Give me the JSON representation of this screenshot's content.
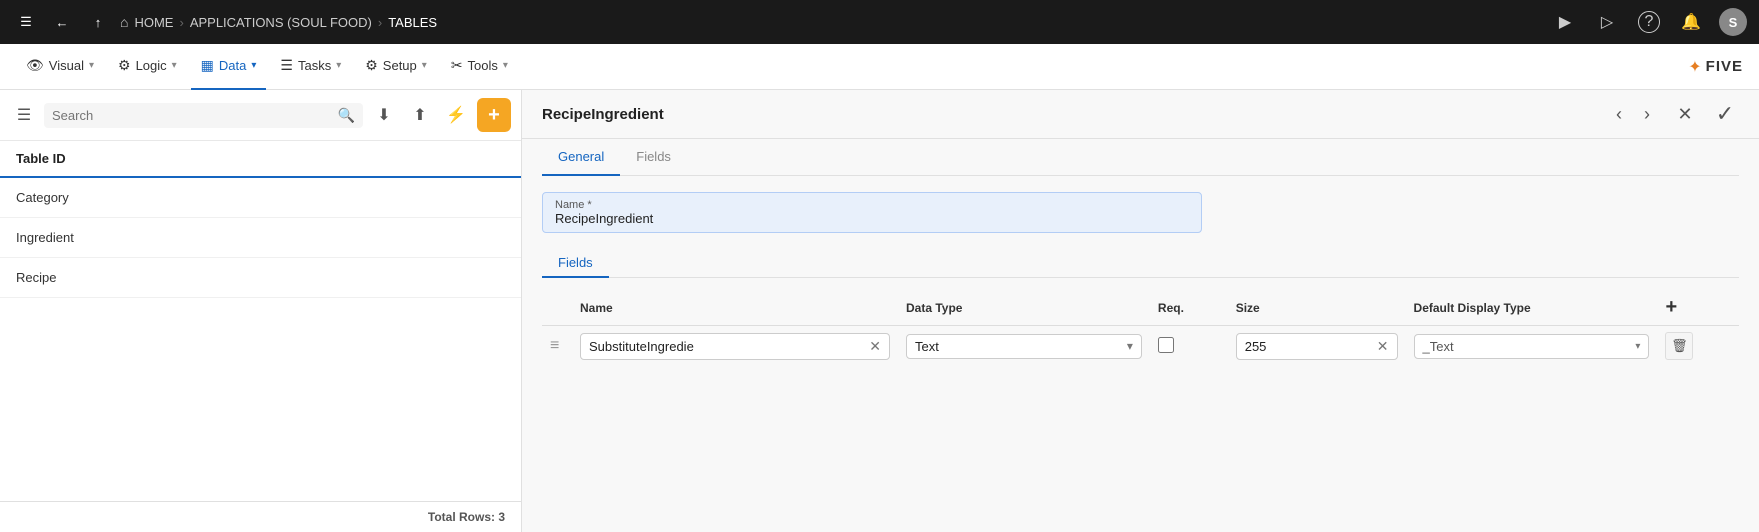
{
  "topbar": {
    "menu_icon": "☰",
    "back_icon": "←",
    "up_icon": "↑",
    "home_icon": "⌂",
    "home_label": "HOME",
    "sep1": "›",
    "app_label": "APPLICATIONS (SOUL FOOD)",
    "sep2": "›",
    "tables_label": "TABLES",
    "play_icon": "▶",
    "replay_icon": "⏵",
    "help_icon": "?",
    "bell_icon": "🔔",
    "avatar_label": "S"
  },
  "secondbar": {
    "visual_icon": "👁",
    "visual_label": "Visual",
    "logic_icon": "⚙",
    "logic_label": "Logic",
    "data_icon": "▦",
    "data_label": "Data",
    "tasks_icon": "☰",
    "tasks_label": "Tasks",
    "setup_icon": "⚙",
    "setup_label": "Setup",
    "tools_icon": "✂",
    "tools_label": "Tools",
    "five_logo": "✦FIVE"
  },
  "sidebar": {
    "search_placeholder": "Search",
    "table_id_header": "Table ID",
    "rows": [
      {
        "label": "Category"
      },
      {
        "label": "Ingredient"
      },
      {
        "label": "Recipe"
      }
    ],
    "total_rows_label": "Total Rows: 3"
  },
  "panel": {
    "title": "RecipeIngredient",
    "close_icon": "✕",
    "confirm_icon": "✓",
    "prev_icon": "‹",
    "next_icon": "›",
    "tabs": [
      {
        "label": "General",
        "active": true
      },
      {
        "label": "Fields",
        "active": false
      }
    ],
    "general": {
      "name_label": "Name *",
      "name_value": "RecipeIngredient"
    },
    "fields": {
      "columns": [
        {
          "label": ""
        },
        {
          "label": "Name"
        },
        {
          "label": "Data Type"
        },
        {
          "label": "Req."
        },
        {
          "label": "Size"
        },
        {
          "label": "Default Display Type"
        },
        {
          "label": "+"
        }
      ],
      "rows": [
        {
          "name": "SubstituteIngredie",
          "data_type": "Text",
          "req": false,
          "size": "255",
          "display_type": "_Text"
        }
      ]
    }
  }
}
